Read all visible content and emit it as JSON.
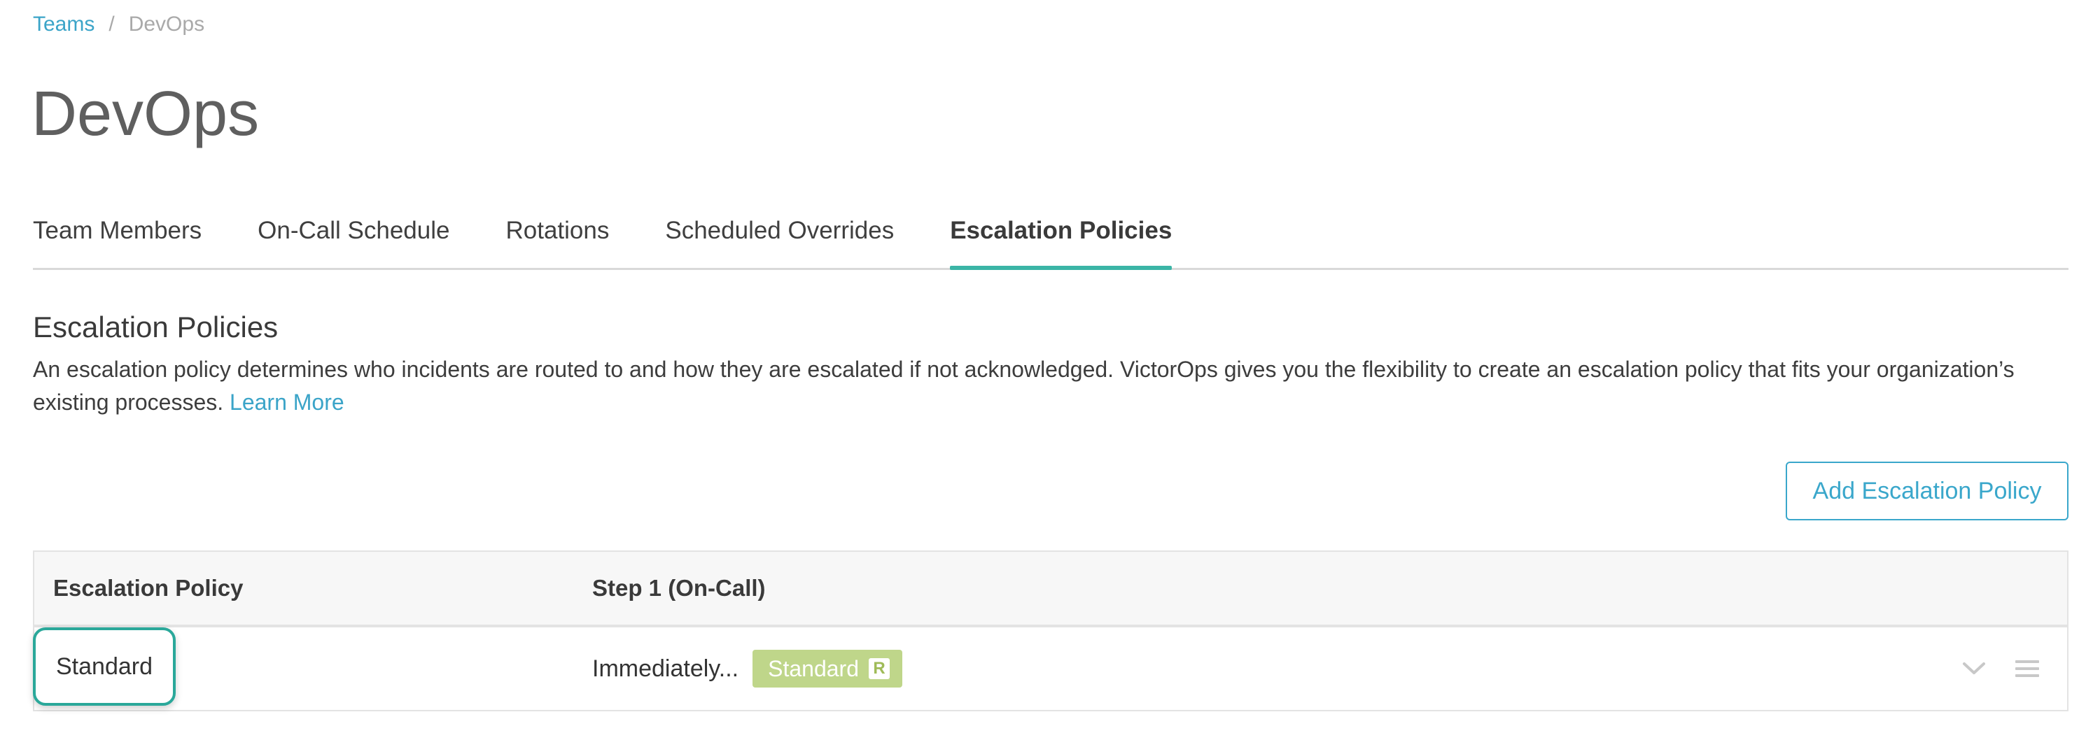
{
  "breadcrumb": {
    "parent": "Teams",
    "separator": "/",
    "current": "DevOps"
  },
  "page": {
    "title": "DevOps"
  },
  "tabs": [
    {
      "label": "Team Members",
      "active": false
    },
    {
      "label": "On-Call Schedule",
      "active": false
    },
    {
      "label": "Rotations",
      "active": false
    },
    {
      "label": "Scheduled Overrides",
      "active": false
    },
    {
      "label": "Escalation Policies",
      "active": true
    }
  ],
  "section": {
    "title": "Escalation Policies",
    "description": "An escalation policy determines who incidents are routed to and how they are escalated if not acknowledged. VictorOps gives you the flexibility to create an escalation policy that fits your organization’s existing processes.",
    "learn_more": "Learn More"
  },
  "toolbar": {
    "add_label": "Add Escalation Policy"
  },
  "table": {
    "columns": [
      "Escalation Policy",
      "Step 1 (On-Call)"
    ],
    "rows": [
      {
        "name": "Standard",
        "step_text": "Immediately...",
        "badge_label": "Standard",
        "badge_marker": "R",
        "actions": [
          "chevron-down-icon",
          "drag-handle-icon"
        ]
      }
    ]
  },
  "colors": {
    "link": "#3ba4c8",
    "tab_accent": "#3bb5a6",
    "highlight_border": "#2aa89a",
    "badge_bg": "#bfd68a",
    "title": "#5f5f5f"
  }
}
